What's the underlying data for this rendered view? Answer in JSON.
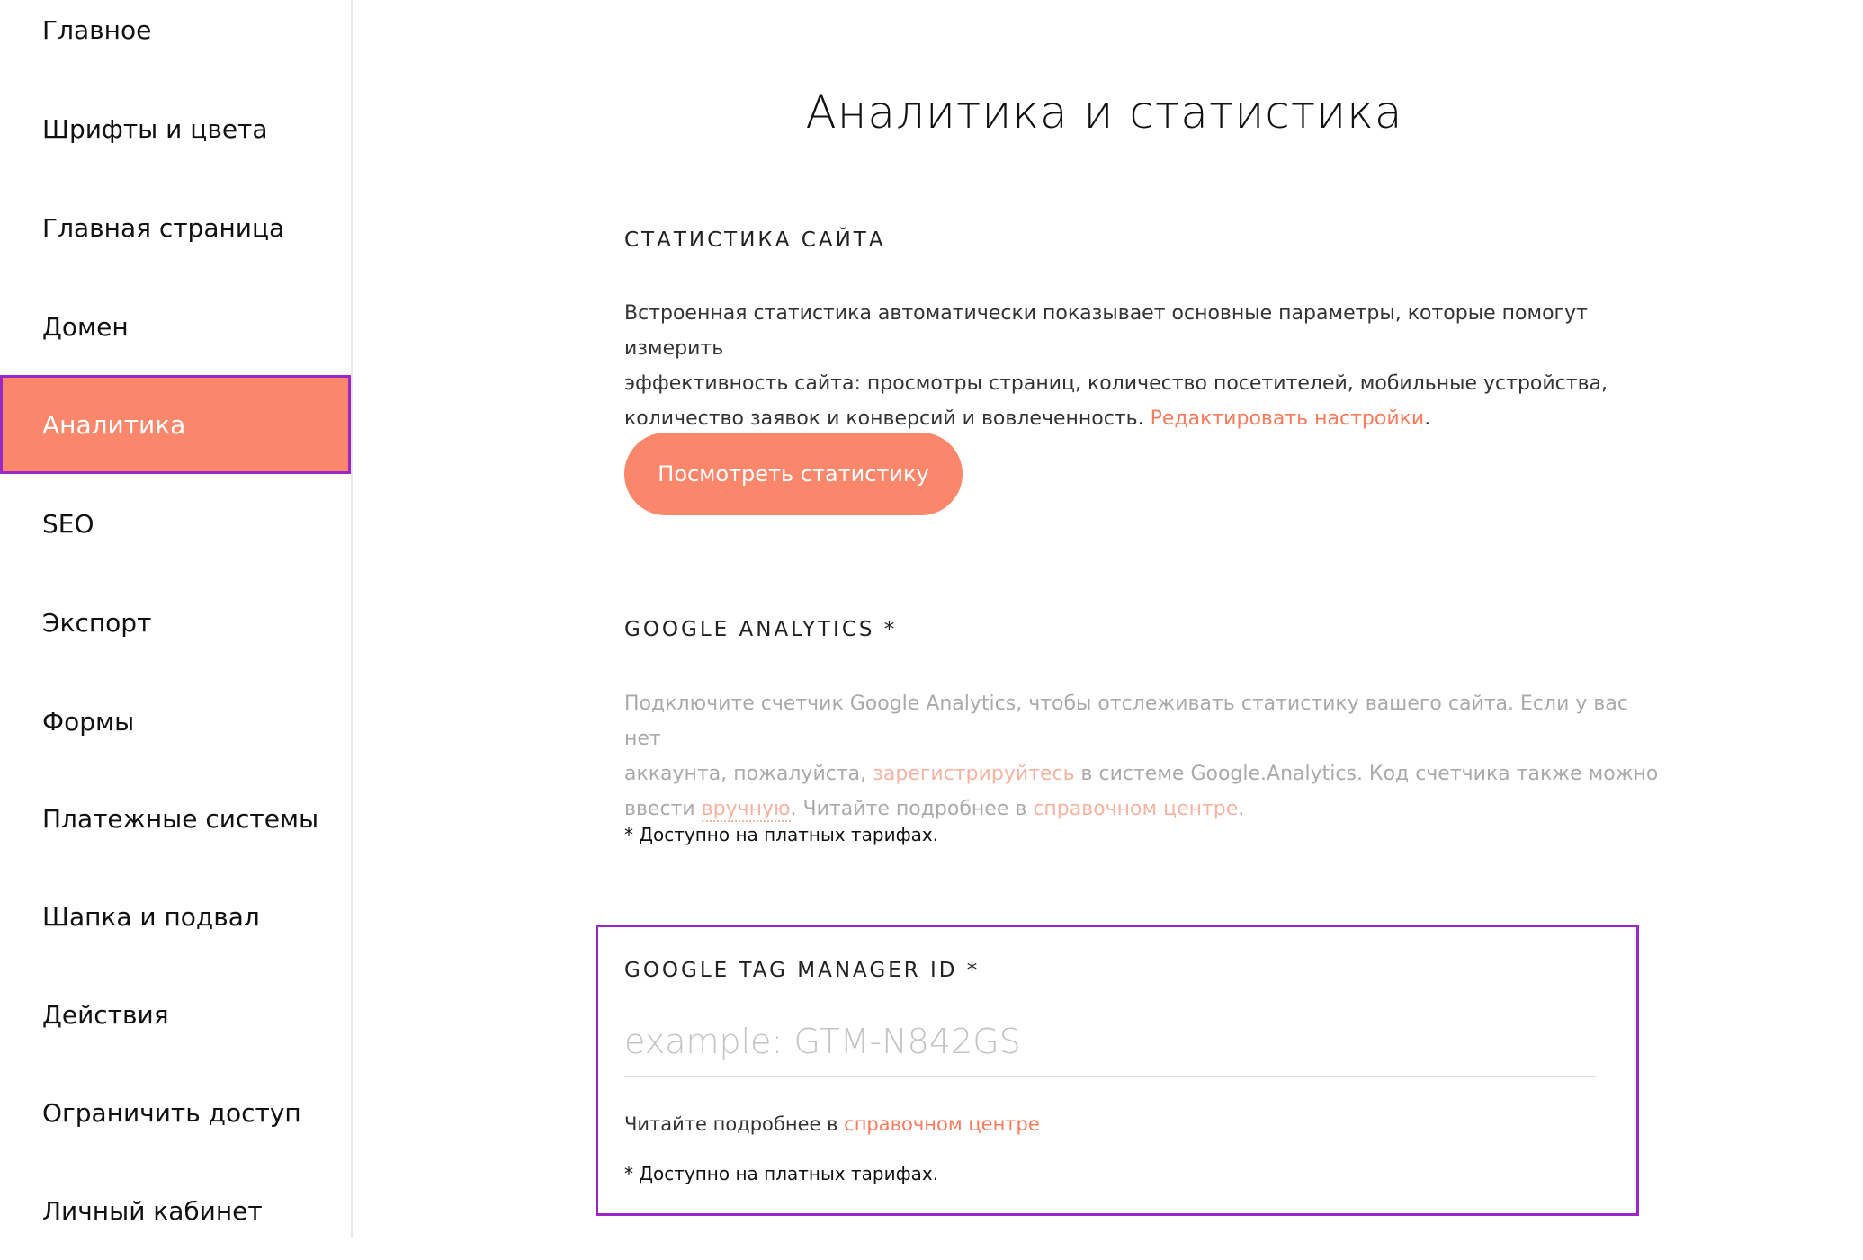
{
  "sidebar": {
    "items": [
      {
        "label": "Главное"
      },
      {
        "label": "Шрифты и цвета"
      },
      {
        "label": "Главная страница"
      },
      {
        "label": "Домен"
      },
      {
        "label": "Аналитика",
        "active": true
      },
      {
        "label": "SEO"
      },
      {
        "label": "Экспорт"
      },
      {
        "label": "Формы"
      },
      {
        "label": "Платежные системы"
      },
      {
        "label": "Шапка и подвал"
      },
      {
        "label": "Действия"
      },
      {
        "label": "Ограничить доступ"
      },
      {
        "label": "Личный кабинет"
      }
    ]
  },
  "main": {
    "title": "Аналитика и статистика",
    "site_stats": {
      "heading": "СТАТИСТИКА САЙТА",
      "line1": "Встроенная статистика автоматически показывает основные параметры, которые помогут измерить",
      "line2": "эффективность сайта: просмотры страниц, количество посетителей, мобильные устройства,",
      "line3_text": "количество заявок и конверсий и вовлеченность. ",
      "edit_link": "Редактировать настройки",
      "line3_end": ".",
      "button_label": "Посмотреть статистику"
    },
    "google_analytics": {
      "heading": "GOOGLE ANALYTICS *",
      "line1": "Подключите счетчик Google Analytics, чтобы отслеживать статистику вашего сайта. Если у вас нет",
      "line2_a": "аккаунта, пожалуйста, ",
      "register_link": "зарегистрируйтесь",
      "line2_b": " в системе Google.Analytics. Код счетчика также можно",
      "line3_a": "ввести ",
      "manual_link": "вручную",
      "line3_b": ". Читайте подробнее в ",
      "help_link": "справочном центре",
      "line3_end": ".",
      "note": "* Доступно на платных тарифах."
    },
    "gtm": {
      "heading": "GOOGLE TAG MANAGER ID *",
      "placeholder": "example: GTM-N842GS",
      "value": "",
      "read_more": "Читайте подробнее в ",
      "help_link": "справочном центре",
      "note": "* Доступно на платных тарифах."
    }
  },
  "colors": {
    "accent": "#fa876b",
    "link": "#fa7a5c",
    "highlight_border": "#9b27c8"
  }
}
